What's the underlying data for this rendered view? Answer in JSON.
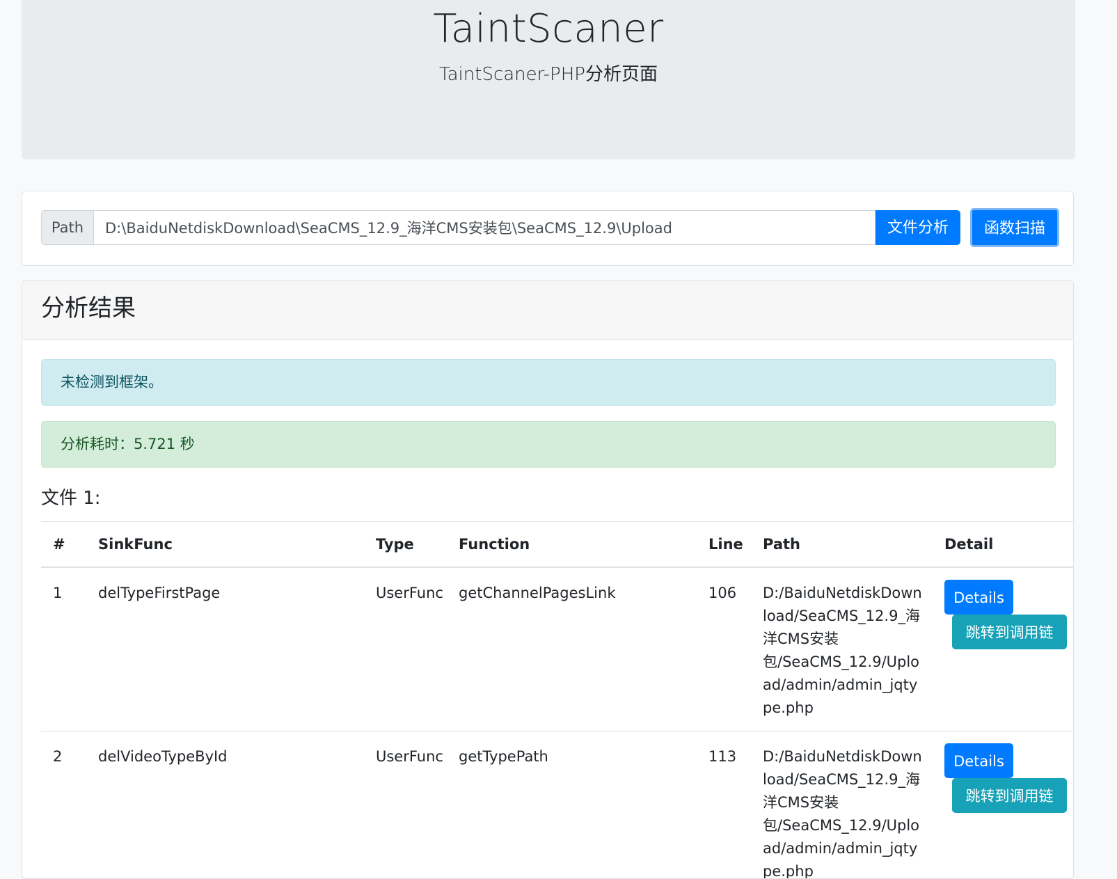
{
  "header": {
    "title": "TaintScaner",
    "subtitle": "TaintScaner-PHP分析页面"
  },
  "path_form": {
    "prepend_label": "Path",
    "path_value": "D:\\BaiduNetdiskDownload\\SeaCMS_12.9_海洋CMS安装包\\SeaCMS_12.9\\Upload",
    "analyze_button": "文件分析",
    "scan_button": "函数扫描"
  },
  "results": {
    "heading": "分析结果",
    "framework_alert": "未检测到框架。",
    "time_alert": "分析耗时：5.721 秒",
    "file_title": "文件 1:",
    "columns": [
      "#",
      "SinkFunc",
      "Type",
      "Function",
      "Line",
      "Path",
      "Detail"
    ],
    "rows": [
      {
        "index": "1",
        "sink_func": "delTypeFirstPage",
        "type": "UserFunc",
        "function": "getChannelPagesLink",
        "line": "106",
        "path": "D:/BaiduNetdiskDownload/SeaCMS_12.9_海洋CMS安装包/SeaCMS_12.9/Upload/admin/admin_jqtype.php",
        "details_label": "Details",
        "chain_label": "跳转到调用链"
      },
      {
        "index": "2",
        "sink_func": "delVideoTypeById",
        "type": "UserFunc",
        "function": "getTypePath",
        "line": "113",
        "path": "D:/BaiduNetdiskDownload/SeaCMS_12.9_海洋CMS安装包/SeaCMS_12.9/Upload/admin/admin_jqtype.php",
        "details_label": "Details",
        "chain_label": "跳转到调用链"
      }
    ]
  },
  "colors": {
    "primary": "#007bff",
    "info": "#17a2b8",
    "alert_info_bg": "#d1ecf1",
    "alert_success_bg": "#d4edda"
  }
}
